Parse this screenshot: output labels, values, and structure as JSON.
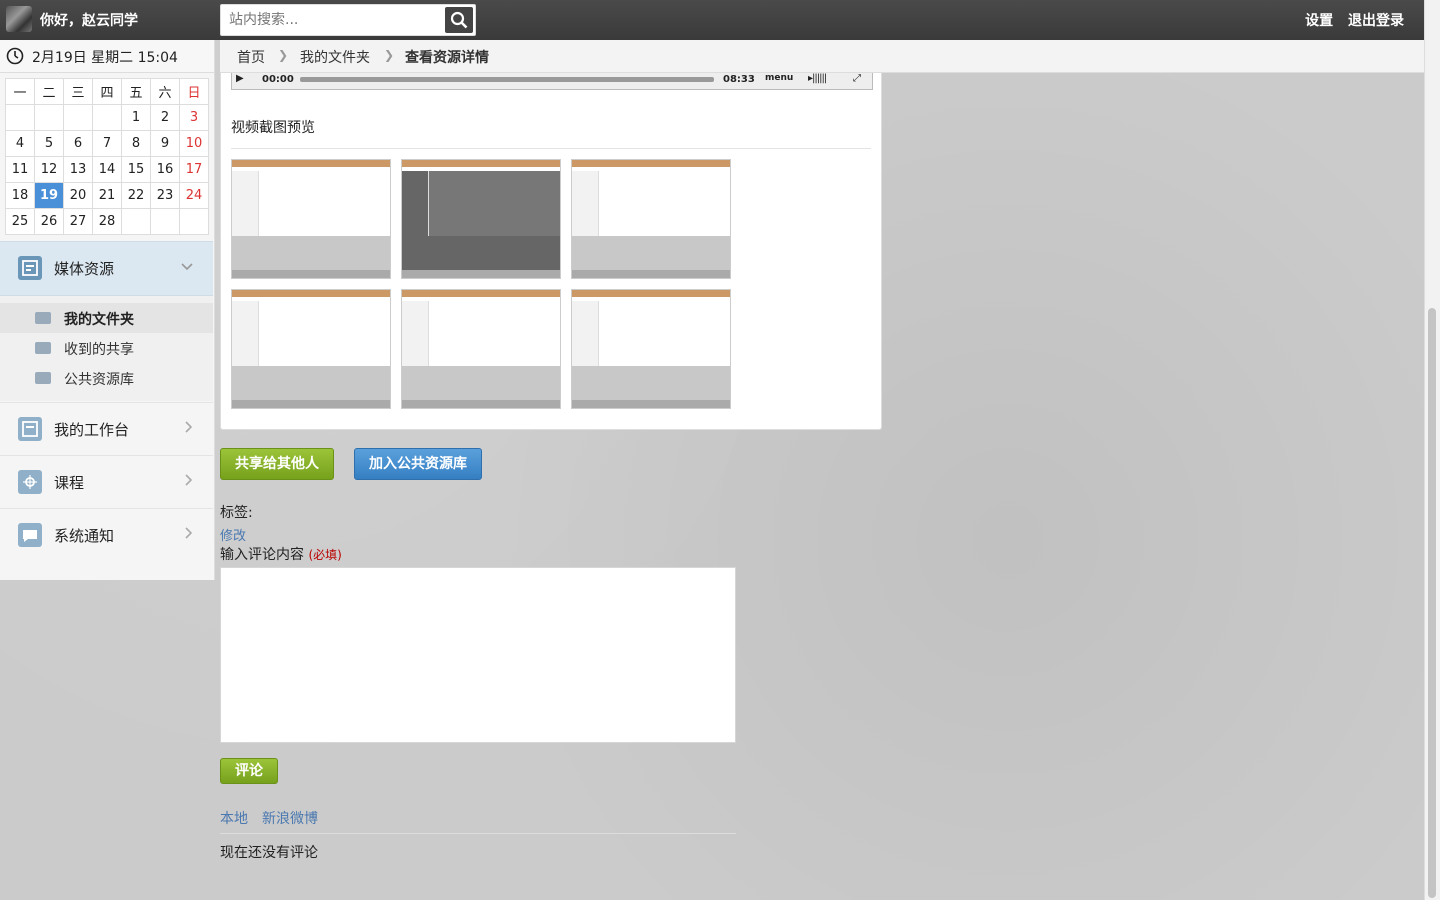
{
  "topbar": {
    "greeting": "你好，赵云同学",
    "search_placeholder": "站内搜索...",
    "settings": "设置",
    "logout": "退出登录"
  },
  "sidebar": {
    "datetime": "2月19日 星期二 15:04",
    "calendar": {
      "weekdays": [
        "一",
        "二",
        "三",
        "四",
        "五",
        "六",
        "日"
      ],
      "weeks": [
        [
          "",
          "",
          "",
          "",
          "1",
          "2",
          "3"
        ],
        [
          "4",
          "5",
          "6",
          "7",
          "8",
          "9",
          "10"
        ],
        [
          "11",
          "12",
          "13",
          "14",
          "15",
          "16",
          "17"
        ],
        [
          "18",
          "19",
          "20",
          "21",
          "22",
          "23",
          "24"
        ],
        [
          "25",
          "26",
          "27",
          "28",
          "",
          "",
          ""
        ]
      ],
      "today": "19"
    },
    "nav": {
      "media": "媒体资源",
      "sub": [
        "我的文件夹",
        "收到的共享",
        "公共资源库"
      ],
      "workbench": "我的工作台",
      "course": "课程",
      "notice": "系统通知"
    }
  },
  "breadcrumb": {
    "home": "首页",
    "folder": "我的文件夹",
    "current": "查看资源详情"
  },
  "player": {
    "time_current": "00:00",
    "time_total": "08:33",
    "menu": "menu"
  },
  "preview": {
    "title": "视频截图预览"
  },
  "actions": {
    "share": "共享给其他人",
    "add_public": "加入公共资源库"
  },
  "tags": {
    "label": "标签:",
    "edit": "修改"
  },
  "comment": {
    "label": "输入评论内容",
    "required": "(必填)",
    "submit": "评论",
    "tab_local": "本地",
    "tab_weibo": "新浪微博",
    "empty": "现在还没有评论"
  },
  "colors": {
    "topbar": "#3f3f3f",
    "accent_blue": "#4a90d9",
    "green_button": "#8bb52a",
    "blue_button": "#4a8fd0"
  }
}
